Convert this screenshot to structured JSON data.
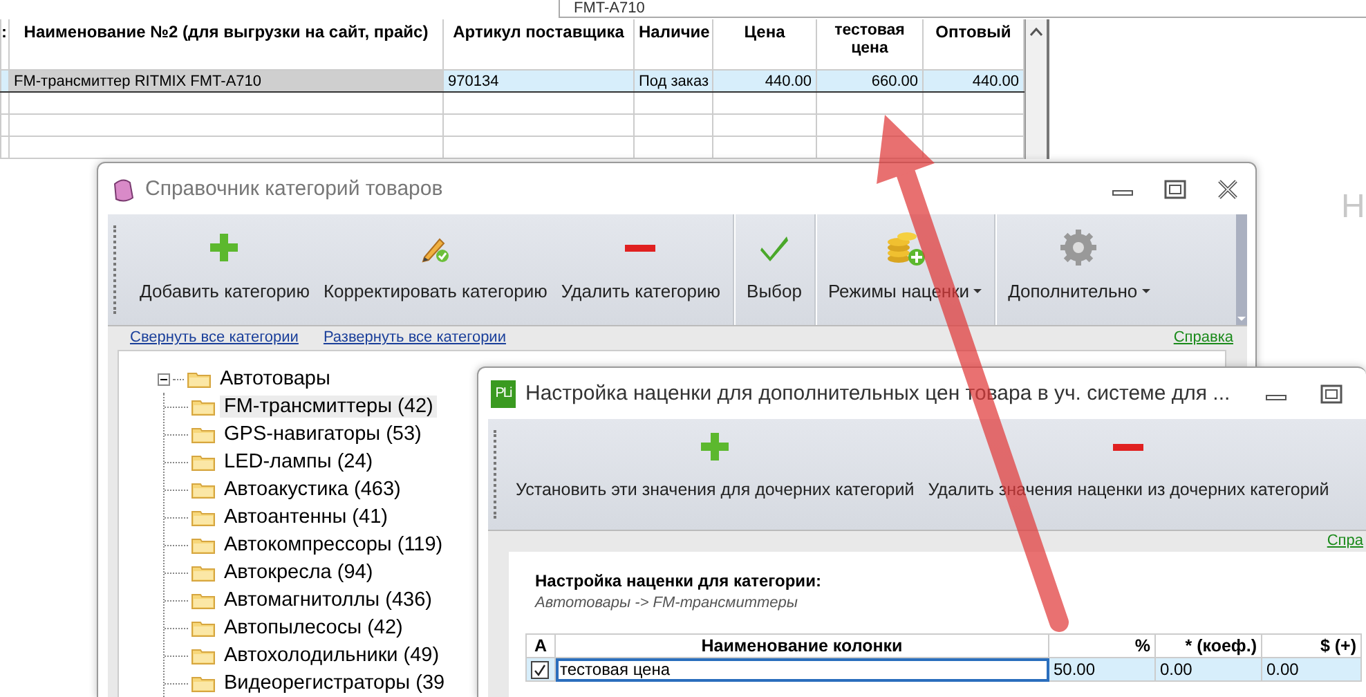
{
  "background_window": {
    "search_value": "FMT-A710",
    "side_text": "Н",
    "table": {
      "columns": [
        ":",
        "Наименование №2 (для выгрузки на сайт, прайс)",
        "Артикул поставщика",
        "Наличие",
        "Цена",
        "тестовая цена",
        "Оптовый"
      ],
      "rows": [
        {
          "selected": true,
          "cells": [
            {
              "text": "",
              "focused": false
            },
            {
              "text": "FM-трансмиттер RITMIX FMT-A710",
              "focused": true
            },
            {
              "text": "970134",
              "focused": false
            },
            {
              "text": "Под заказ",
              "focused": false
            },
            {
              "text": "440.00",
              "focused": false
            },
            {
              "text": "660.00",
              "focused": false
            },
            {
              "text": "440.00",
              "focused": false
            }
          ]
        }
      ]
    }
  },
  "category_window": {
    "title": "Справочник категорий товаров",
    "toolbar": [
      {
        "label": "Добавить категорию",
        "kind": "add",
        "dropdown": false,
        "group_start": false
      },
      {
        "label": "Корректировать категорию",
        "kind": "edit",
        "dropdown": false,
        "group_start": false
      },
      {
        "label": "Удалить категорию",
        "kind": "delete",
        "dropdown": false,
        "group_start": false
      },
      {
        "label": "Выбор",
        "kind": "select",
        "dropdown": false,
        "group_start": true
      },
      {
        "label": "Режимы наценки",
        "kind": "coins",
        "dropdown": true,
        "group_start": true
      },
      {
        "label": "Дополнительно",
        "kind": "gear",
        "dropdown": true,
        "group_start": true
      }
    ],
    "links": [
      "Свернуть все категории",
      "Развернуть все категории"
    ],
    "help_link": "Справка",
    "tree": [
      {
        "label": "Автотовары",
        "expanded": true,
        "children": [
          {
            "label": "FM-трансмиттеры (42)",
            "selected": true
          },
          {
            "label": "GPS-навигаторы (53)",
            "selected": false
          },
          {
            "label": "LED-лампы (24)",
            "selected": false
          },
          {
            "label": "Автоакустика (463)",
            "selected": false
          },
          {
            "label": "Автоантенны (41)",
            "selected": false
          },
          {
            "label": "Автокомпрессоры (119)",
            "selected": false
          },
          {
            "label": "Автокресла (94)",
            "selected": false
          },
          {
            "label": "Автомагнитоллы (436)",
            "selected": false
          },
          {
            "label": "Автопылесосы (42)",
            "selected": false
          },
          {
            "label": "Автохолодильники (49)",
            "selected": false
          },
          {
            "label": "Видеорегистраторы (39",
            "selected": false
          }
        ]
      }
    ]
  },
  "markup_window": {
    "app_icon_text": "PLi",
    "title": "Настройка наценки для дополнительных цен товара в уч. системе для ...",
    "toolbar": [
      {
        "label": "Установить эти значения для дочерних категорий",
        "kind": "add"
      },
      {
        "label": "Удалить значения наценки из дочерних категорий",
        "kind": "delete"
      }
    ],
    "help_link": "Спра",
    "heading": "Настройка наценки для категории:",
    "path": "Автотовары -> FM-трансмиттеры",
    "table": {
      "columns": [
        "А",
        "Наименование колонки",
        "%",
        "* (коеф.)",
        "$ (+)"
      ],
      "rows": [
        {
          "selected": true,
          "cells": [
            {
              "kind": "check",
              "checked": true
            },
            {
              "kind": "text",
              "text": "тестовая цена",
              "editing": true
            },
            {
              "kind": "text",
              "text": "50.00",
              "editing": false
            },
            {
              "kind": "text",
              "text": "0.00",
              "editing": false
            },
            {
              "kind": "text",
              "text": "0.00",
              "editing": false
            }
          ]
        }
      ]
    }
  }
}
